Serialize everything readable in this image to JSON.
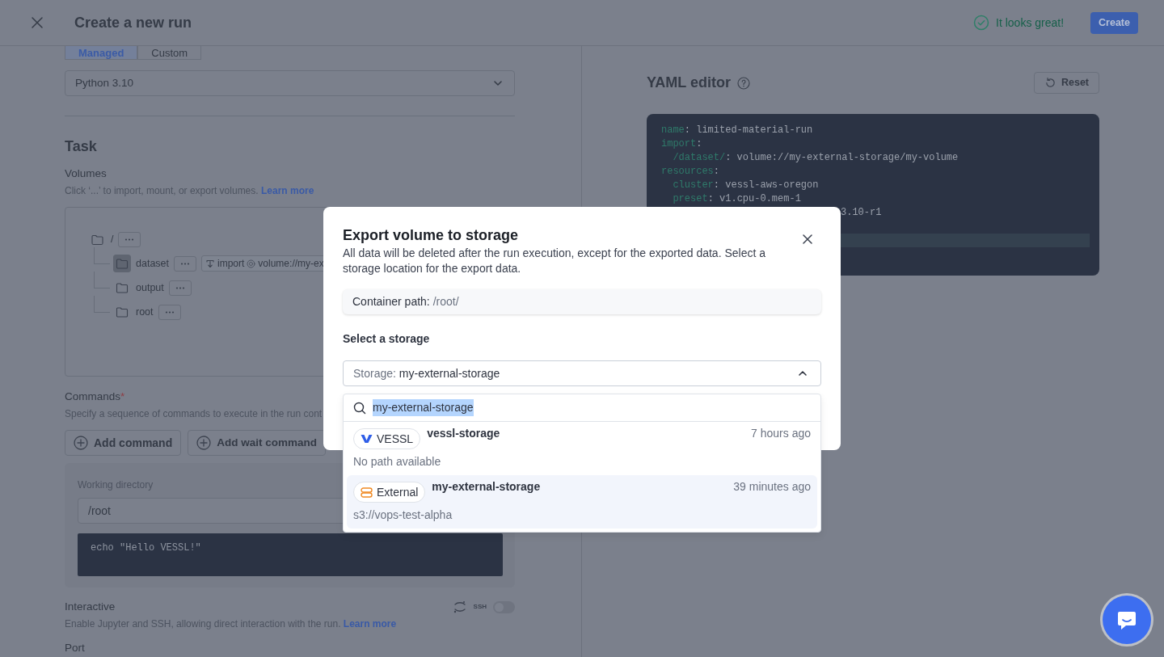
{
  "header": {
    "title": "Create a new run",
    "status": "It looks great!",
    "create_button": "Create"
  },
  "image_tabs": [
    {
      "label": "Managed",
      "selected": true
    },
    {
      "label": "Custom",
      "selected": false
    }
  ],
  "python_select": {
    "value": "Python 3.10"
  },
  "task": {
    "title": "Task",
    "volumes": {
      "label": "Volumes",
      "hint": "Click ‘...’ to import, mount, or export volumes.",
      "link": "Learn more",
      "tree": {
        "name": "/",
        "children": [
          {
            "name": "dataset",
            "highlighted": true,
            "tag": {
              "action": "import",
              "target": "volume://my-ex"
            }
          },
          {
            "name": "output",
            "highlighted": false
          },
          {
            "name": "root",
            "highlighted": false
          }
        ]
      }
    },
    "commands": {
      "label": "Commands",
      "required_mark": "*",
      "hint": "Specify a sequence of commands to execute in the run cont",
      "buttons": [
        "Add command",
        "Add wait command"
      ],
      "working_directory": {
        "label": "Working directory",
        "value": "/root"
      },
      "script": "echo \"Hello VESSL!\""
    },
    "interactive": {
      "label": "Interactive",
      "hint": "Enable Jupyter and SSH, allowing direct interaction with the run.",
      "link": "Learn more",
      "ssh_label": "SSH",
      "on": false
    },
    "port": {
      "label": "Port"
    }
  },
  "yaml_editor": {
    "title": "YAML editor",
    "reset_button": "Reset",
    "lines": [
      {
        "key": "name",
        "colon": ":",
        "value": "limited-material-run"
      },
      {
        "key": "import",
        "colon": ":",
        "children": [
          {
            "key": "/dataset/",
            "colon": ":",
            "value": "volume://my-external-storage/my-volume"
          }
        ]
      },
      {
        "key": "resources",
        "colon": ":",
        "children": [
          {
            "key": "cluster",
            "colon": ":",
            "value": "vessl-aws-oregon"
          },
          {
            "key": "preset",
            "colon": ":",
            "value": "v1.cpu-0.mem-1"
          }
        ]
      },
      {
        "kind": "clipped",
        "value": "3.10-r1"
      }
    ]
  },
  "modal": {
    "title": "Export volume to storage",
    "description": "All data will be deleted after the run execution, except for the exported data. Select a storage location for the export data.",
    "container_path": {
      "label": "Container path:",
      "value": "/root/"
    },
    "select_label": "Select a storage",
    "storage_select": {
      "label": "Storage:",
      "value": "my-external-storage",
      "expanded": true
    },
    "search": {
      "value": "my-external-storage"
    },
    "storages": [
      {
        "kind": "vessl",
        "badge": "VESSL",
        "name": "vessl-storage",
        "time": "7 hours ago",
        "path": "No path available",
        "selected": false
      },
      {
        "kind": "external",
        "badge": "External",
        "name": "my-external-storage",
        "time": "39 minutes ago",
        "path": "s3://vops-test-alpha",
        "selected": true
      }
    ]
  }
}
